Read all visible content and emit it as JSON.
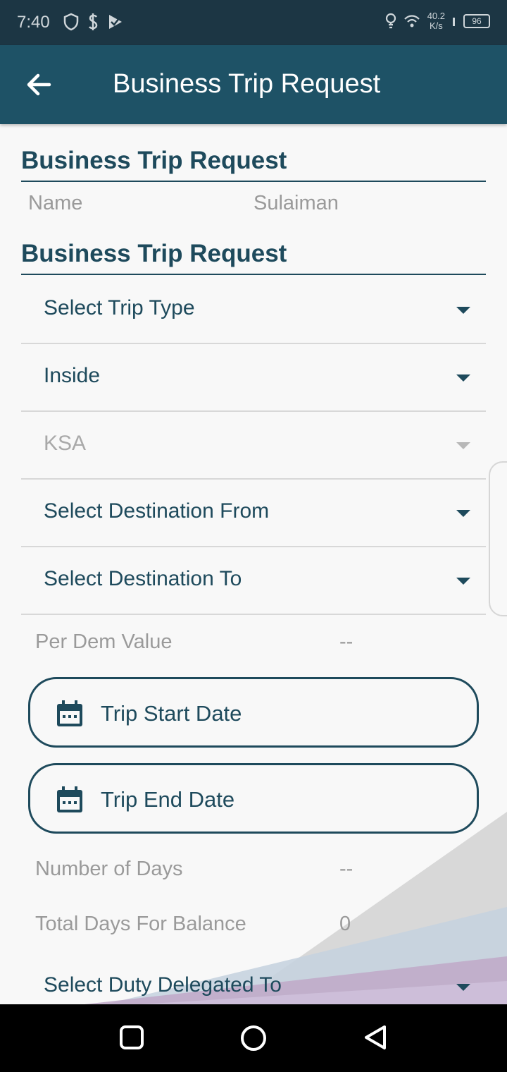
{
  "status_bar": {
    "time": "7:40",
    "net_speed_value": "40.2",
    "net_speed_unit": "K/s",
    "battery": "96",
    "left_icons": [
      "shield-icon",
      "dollar-icon",
      "play-store-icon"
    ],
    "right_icons": [
      "bulb-icon",
      "wifi-icon",
      "signal-icon",
      "battery-icon"
    ]
  },
  "app_bar": {
    "title": "Business Trip Request",
    "back_icon": "arrow-left-icon"
  },
  "section1": {
    "title": "Business Trip Request",
    "name_label": "Name",
    "name_value": "Sulaiman"
  },
  "section2": {
    "title": "Business Trip Request"
  },
  "dropdowns": {
    "trip_type": "Select Trip Type",
    "inside": "Inside",
    "country": "KSA",
    "destination_from": "Select Destination From",
    "destination_to": "Select Destination To",
    "duty_delegated": "Select Duty Delegated To"
  },
  "per_diem": {
    "label": "Per Dem Value",
    "value": "--"
  },
  "dates": {
    "start_label": "Trip Start Date",
    "end_label": "Trip End Date",
    "icon": "calendar-icon"
  },
  "days": {
    "number_label": "Number of Days",
    "number_value": "--",
    "balance_label": "Total Days For Balance",
    "balance_value": "0"
  },
  "colors": {
    "status_bar": "#1c3644",
    "app_bar": "#1e5266",
    "primary_text": "#1e4a5c",
    "muted_text": "#9a9a9a",
    "background": "#f8f8f8"
  },
  "nav_bar": {
    "buttons": [
      "recents-square-icon",
      "home-circle-icon",
      "back-triangle-icon"
    ]
  }
}
